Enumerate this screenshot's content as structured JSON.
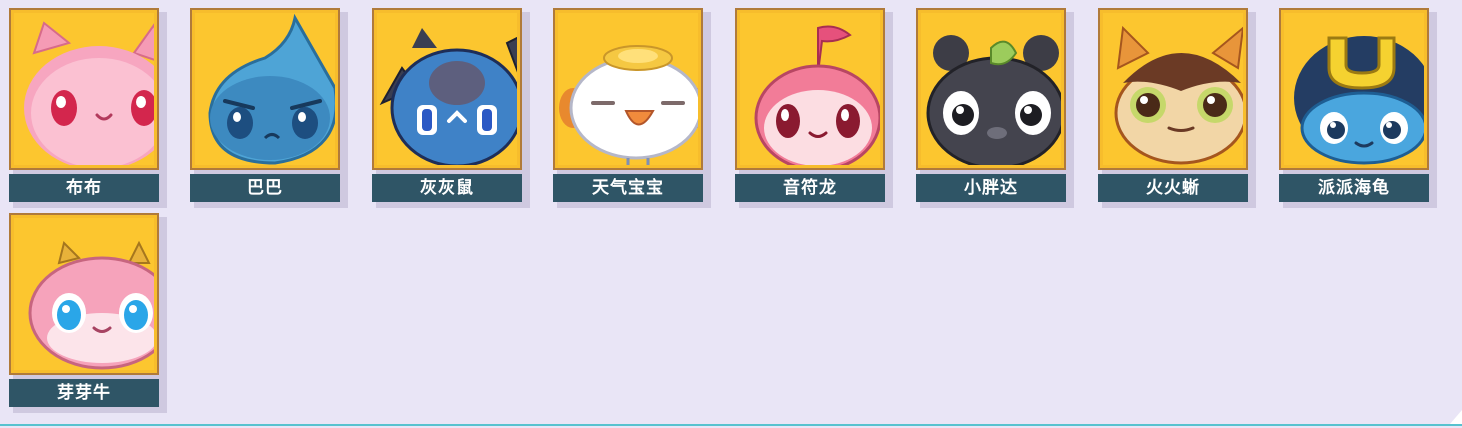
{
  "pets": [
    {
      "name": "布布",
      "icon": "pink-cat-pet-icon"
    },
    {
      "name": "巴巴",
      "icon": "blue-water-drop-pet-icon"
    },
    {
      "name": "灰灰鼠",
      "icon": "blue-bat-mouse-pet-icon"
    },
    {
      "name": "天气宝宝",
      "icon": "white-egg-bird-pet-icon"
    },
    {
      "name": "音符龙",
      "icon": "pink-music-note-pet-icon"
    },
    {
      "name": "小胖达",
      "icon": "black-panda-pet-icon"
    },
    {
      "name": "火火蜥",
      "icon": "fire-lizard-pet-icon"
    },
    {
      "name": "派派海龟",
      "icon": "blue-sea-turtle-pet-icon"
    },
    {
      "name": "芽芽牛",
      "icon": "pink-sprout-cow-pet-icon"
    }
  ],
  "colors": {
    "background": "#e9e5f6",
    "card_bg": "#fcc62f",
    "card_border": "#b07a3a",
    "label_bg": "#2f5566",
    "label_text": "#ffffff",
    "accent_line": "#56c2cf"
  }
}
